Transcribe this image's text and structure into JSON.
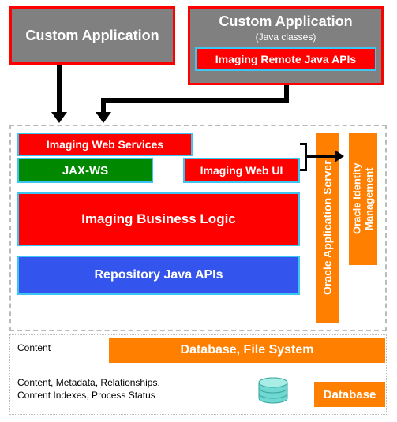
{
  "top": {
    "custom_app1": "Custom Application",
    "custom_app2_title": "Custom Application",
    "custom_app2_subtitle": "(Java classes)",
    "remote_apis": "Imaging Remote Java APIs"
  },
  "main": {
    "imaging_ws": "Imaging Web Services",
    "jaxws": "JAX-WS",
    "webui": "Imaging Web UI",
    "biz_logic": "Imaging Business Logic",
    "repo_apis": "Repository Java APIs",
    "app_server": "Oracle Application Server",
    "identity": "Oracle Identity Management"
  },
  "bottom": {
    "content_label": "Content",
    "db_fs": "Database, File System",
    "content_desc": "Content, Metadata, Relationships,\nContent Indexes, Process Status",
    "database": "Database"
  }
}
